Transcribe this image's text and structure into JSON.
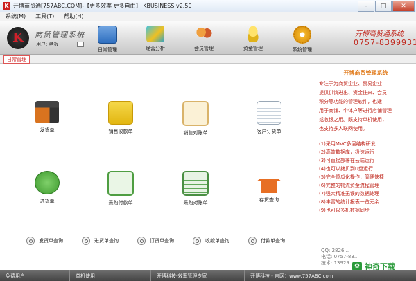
{
  "window": {
    "title": "开博商贸通[757ABC.COM]-【更多效率 更多自由】  KBUSINESS v2.50",
    "buttons": {
      "minimize": "–",
      "maximize": "□",
      "close": "✕"
    }
  },
  "menu": [
    "系统(M)",
    "工具(T)",
    "帮助(H)"
  ],
  "header": {
    "logo": {
      "letter": "K"
    },
    "system_name": "商贸管理系统",
    "user": "用户: 老板",
    "company": "开博商贸通系统",
    "phone": "0757-83999317"
  },
  "toolbar": [
    {
      "label": "日常管理",
      "icon": "calendar-icon",
      "color": "#2f6fc0"
    },
    {
      "label": "经营分析",
      "icon": "chart-icon",
      "color": "#2aa2c9"
    },
    {
      "label": "会员管理",
      "icon": "users-icon",
      "color": "#d05a2a"
    },
    {
      "label": "资金管理",
      "icon": "coins-icon",
      "color": "#e0b21a"
    },
    {
      "label": "系统管理",
      "icon": "gear-icon",
      "color": "#e09a14"
    }
  ],
  "tab": "日常管理",
  "tiles": [
    {
      "label": "发货单",
      "icon": "truck-icon",
      "color": "#d9731f"
    },
    {
      "label": "销售收款单",
      "icon": "yen-receipt-icon",
      "color": "#e8c21a"
    },
    {
      "label": "销售对账单",
      "icon": "clipboard-icon",
      "color": "#f3e2b8"
    },
    {
      "label": "客户订货单",
      "icon": "document-icon",
      "color": "#dfe7ef"
    },
    {
      "label": "进货单",
      "icon": "buy-arrow-icon",
      "color": "#4aa93a"
    },
    {
      "label": "采购付款单",
      "icon": "edit-document-icon",
      "color": "#5bb04f"
    },
    {
      "label": "采购对账单",
      "icon": "checklist-icon",
      "color": "#61a85a"
    },
    {
      "label": "存货查询",
      "icon": "house-icon",
      "color": "#e76f24"
    }
  ],
  "queries": [
    "发货单查询",
    "进货单查询",
    "订货单查询",
    "收款单查询",
    "付款单查询"
  ],
  "sidebar": {
    "heading": "开博商贸管理系统",
    "description": "专注于为商贸企业、贸易企业\n提供供销进出、资金往来、会员\n积分等功能的管理软件，也适\n用于商铺、个体户等进行店铺管理\n或收银之用。既支持单机使用，\n也支持多人联网使用。",
    "features": [
      "(1)采用MVC多层结构研发",
      "(2)高效数据库，极速运行",
      "(3)可直接部署在云端运行",
      "(4)也可以拷贝到U盘运行",
      "(5)完全傻瓜化操作，简便快捷",
      "(6)完整的物流资金流程管理",
      "(7)强大精准无误的数据处理",
      "(8)丰富的统计报表一览无余",
      "(9)也可以多机数据同步"
    ],
    "contact": [
      "QQ: 2826...",
      "电话: 0757-83...",
      "技术: 13929..."
    ]
  },
  "watermark": "神奇下载",
  "status": [
    "免费用户",
    "单机使用",
    "开博科技-效率管理专家",
    "开博科技 - 官网：www.757ABC.com"
  ]
}
